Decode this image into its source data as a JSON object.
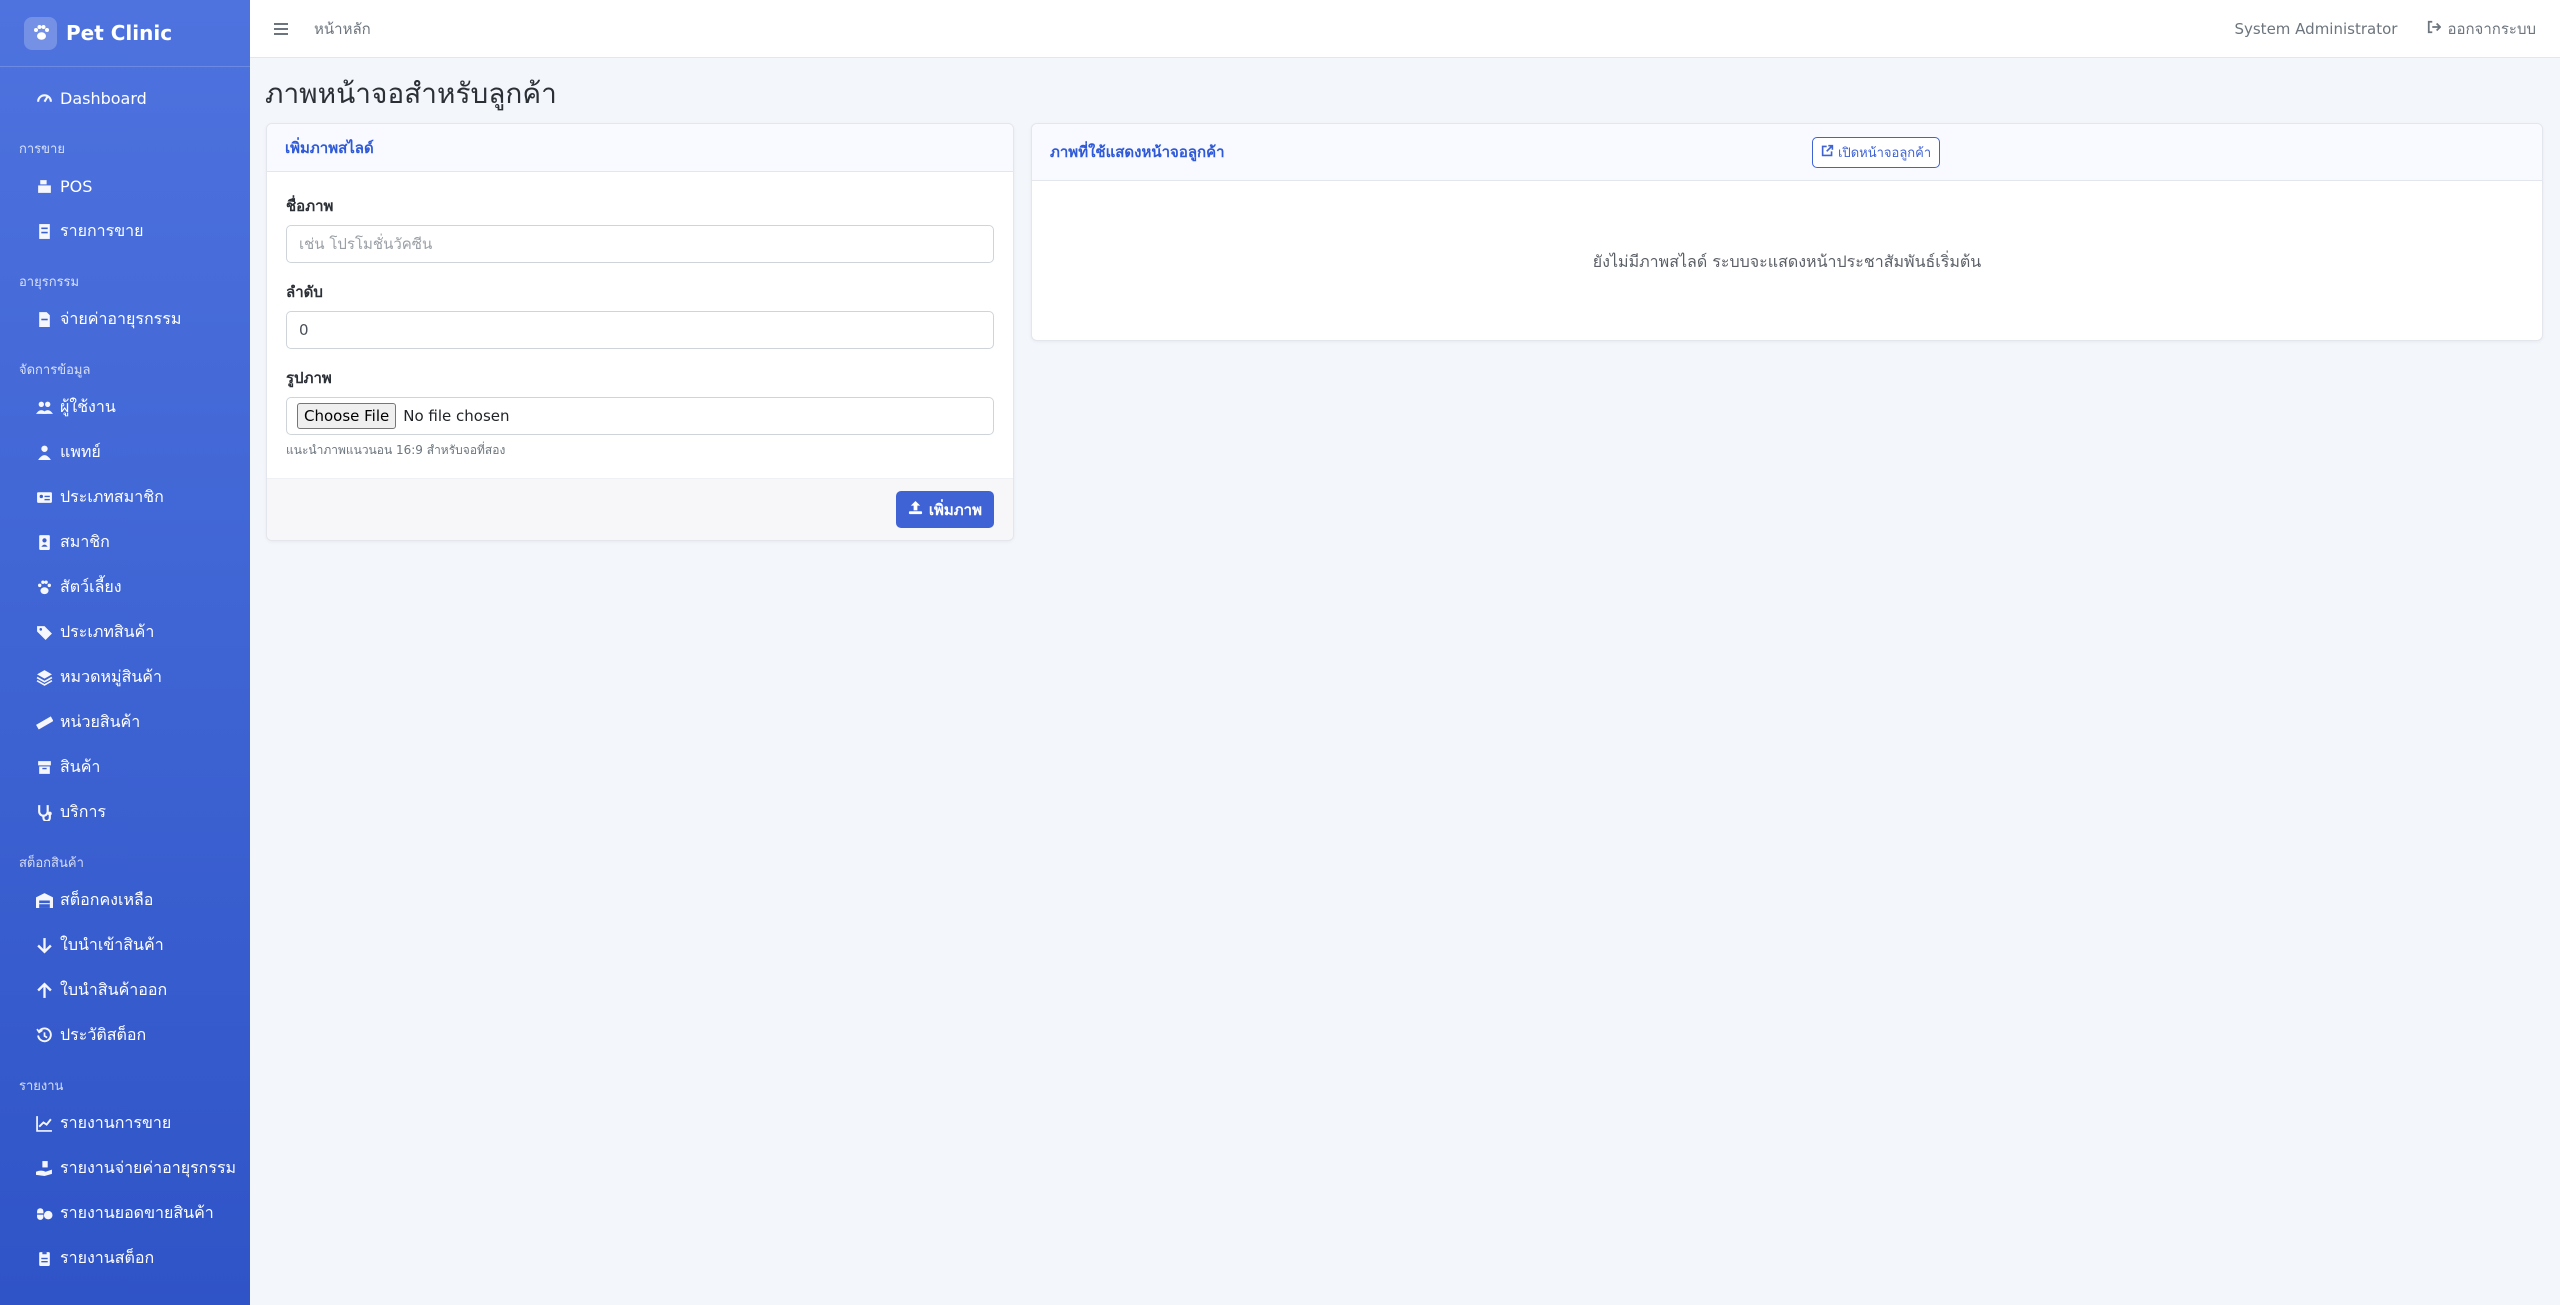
{
  "brand": {
    "name": "Pet Clinic",
    "icon": "paw-icon"
  },
  "sidebar": {
    "dashboard": "Dashboard",
    "sections": [
      {
        "header": "การขาย",
        "items": [
          {
            "label": "POS",
            "icon": "cash-register-icon"
          },
          {
            "label": "รายการขาย",
            "icon": "receipt-icon"
          }
        ]
      },
      {
        "header": "อายุรกรรม",
        "items": [
          {
            "label": "จ่ายค่าอายุรกรรม",
            "icon": "file-invoice-icon"
          }
        ]
      },
      {
        "header": "จัดการข้อมูล",
        "items": [
          {
            "label": "ผู้ใช้งาน",
            "icon": "users-icon"
          },
          {
            "label": "แพทย์",
            "icon": "doctor-icon"
          },
          {
            "label": "ประเภทสมาชิก",
            "icon": "id-card-icon"
          },
          {
            "label": "สมาชิก",
            "icon": "address-book-icon"
          },
          {
            "label": "สัตว์เลี้ยง",
            "icon": "paw-icon"
          },
          {
            "label": "ประเภทสินค้า",
            "icon": "tags-icon"
          },
          {
            "label": "หมวดหมู่สินค้า",
            "icon": "layers-icon"
          },
          {
            "label": "หน่วยสินค้า",
            "icon": "ruler-icon"
          },
          {
            "label": "สินค้า",
            "icon": "box-icon"
          },
          {
            "label": "บริการ",
            "icon": "stethoscope-icon"
          }
        ]
      },
      {
        "header": "สต็อกสินค้า",
        "items": [
          {
            "label": "สต็อกคงเหลือ",
            "icon": "warehouse-icon"
          },
          {
            "label": "ใบนำเข้าสินค้า",
            "icon": "arrow-down-icon"
          },
          {
            "label": "ใบนำสินค้าออก",
            "icon": "arrow-up-icon"
          },
          {
            "label": "ประวัติสต็อก",
            "icon": "history-icon"
          }
        ]
      },
      {
        "header": "รายงาน",
        "items": [
          {
            "label": "รายงานการขาย",
            "icon": "chart-line-icon"
          },
          {
            "label": "รายงานจ่ายค่าอายุรกรรม",
            "icon": "hand-holding-icon"
          },
          {
            "label": "รายงานยอดขายสินค้า",
            "icon": "capsules-icon"
          },
          {
            "label": "รายงานสต็อก",
            "icon": "clipboard-icon"
          }
        ]
      }
    ]
  },
  "topbar": {
    "breadcrumb": "หน้าหลัก",
    "user": "System Administrator",
    "logout": "ออกจากระบบ"
  },
  "page": {
    "title": "ภาพหน้าจอสำหรับลูกค้า"
  },
  "form": {
    "header": "เพิ่มภาพสไลด์",
    "name_label": "ชื่อภาพ",
    "name_placeholder": "เช่น โปรโมชั่นวัคซีน",
    "order_label": "ลำดับ",
    "order_value": "0",
    "image_label": "รูปภาพ",
    "file_button": "Choose File",
    "file_status": "No file chosen",
    "hint": "แนะนำภาพแนวนอน 16:9 สำหรับจอที่สอง",
    "submit": "เพิ่มภาพ"
  },
  "slides": {
    "header": "ภาพที่ใช้แสดงหน้าจอลูกค้า",
    "open_button": "เปิดหน้าจอลูกค้า",
    "empty": "ยังไม่มีภาพสไลด์ ระบบจะแสดงหน้าประชาสัมพันธ์เริ่มต้น"
  }
}
